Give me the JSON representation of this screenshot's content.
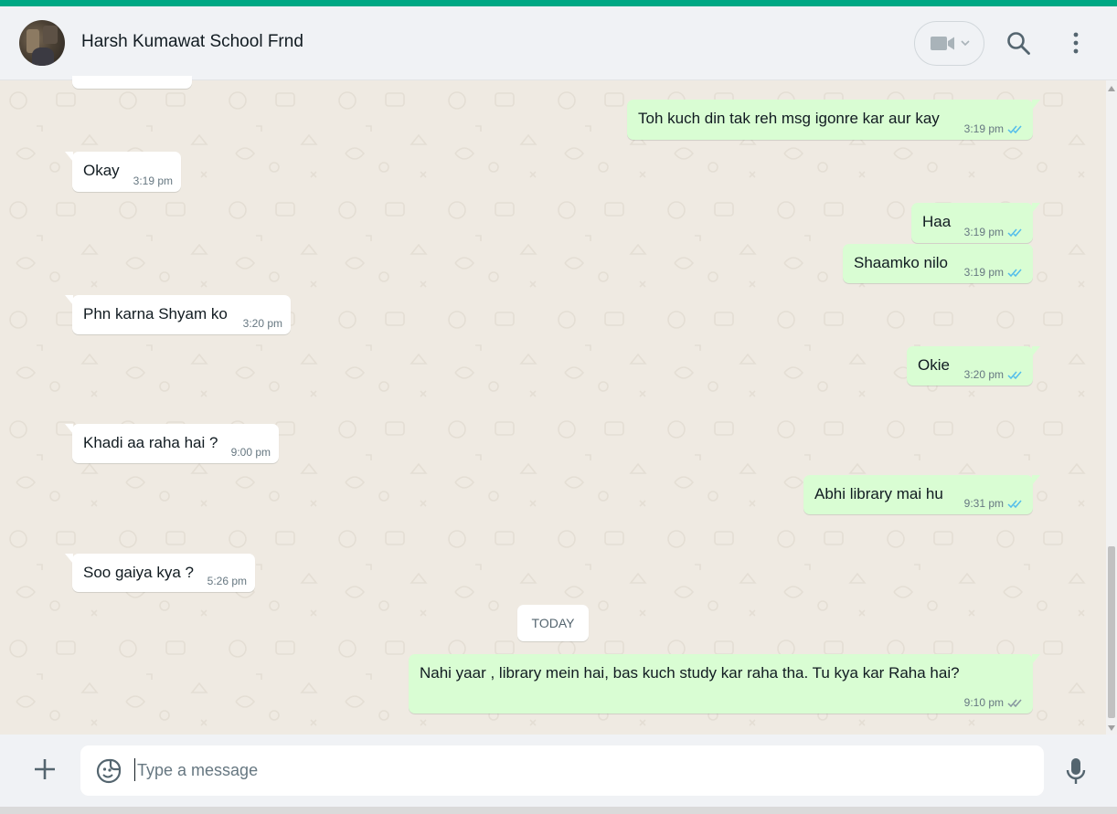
{
  "header": {
    "contact_name": "Harsh Kumawat School Frnd",
    "video_icon": "video-camera-icon",
    "search_icon": "search-icon",
    "menu_icon": "kebab-menu-icon"
  },
  "messages": [
    {
      "direction": "out",
      "text": "Toh kuch din tak reh msg igonre kar aur kay",
      "time": "3:19 pm",
      "status": "read"
    },
    {
      "direction": "in",
      "text": "Okay",
      "time": "3:19 pm"
    },
    {
      "direction": "out",
      "text": "Haa",
      "time": "3:19 pm",
      "status": "read"
    },
    {
      "direction": "out",
      "text": "Shaamko nilo",
      "time": "3:19 pm",
      "status": "read"
    },
    {
      "direction": "in",
      "text": "Phn karna Shyam ko",
      "time": "3:20 pm"
    },
    {
      "direction": "out",
      "text": "Okie",
      "time": "3:20 pm",
      "status": "read"
    },
    {
      "direction": "in",
      "text": "Khadi aa raha hai ?",
      "time": "9:00 pm"
    },
    {
      "direction": "out",
      "text": "Abhi library mai hu",
      "time": "9:31 pm",
      "status": "read"
    },
    {
      "direction": "in",
      "text": "Soo gaiya kya ?",
      "time": "5:26 pm"
    },
    {
      "direction": "out",
      "text": "Nahi yaar , library mein hai, bas kuch study kar raha tha.  Tu kya kar Raha hai?",
      "time": "9:10 pm",
      "status": "delivered"
    }
  ],
  "date_divider": "TODAY",
  "composer": {
    "placeholder": "Type a message",
    "value": ""
  },
  "colors": {
    "accent": "#00a884",
    "outgoing_bubble": "#d9fdd3",
    "incoming_bubble": "#ffffff",
    "read_tick": "#53bdeb",
    "delivered_tick": "#8696a0"
  }
}
